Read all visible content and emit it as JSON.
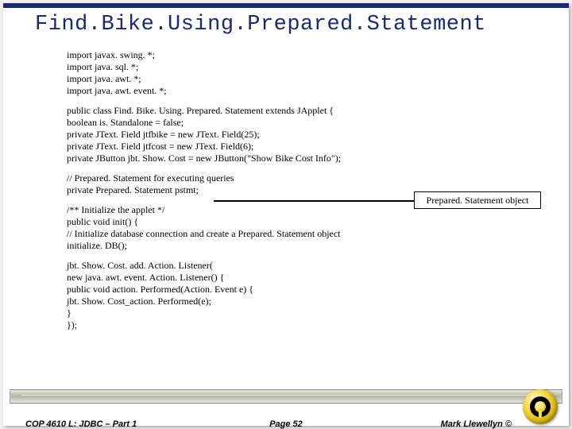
{
  "title": "Find.Bike.Using.Prepared.Statement",
  "code": {
    "imports": [
      "import javax. swing. *;",
      "import java. sql. *;",
      "import java. awt. *;",
      "import java. awt. event. *;"
    ],
    "classDecl": "public class Find. Bike. Using. Prepared. Statement extends JApplet {",
    "fields": [
      " boolean is. Standalone = false;",
      " private JText. Field jtfbike = new JText. Field(25);",
      " private JText. Field jtfcost = new JText. Field(6);",
      " private JButton jbt. Show. Cost = new JButton(\"Show Bike Cost Info\");"
    ],
    "pstmtComment": " // Prepared. Statement for executing queries",
    "pstmtDecl": " private Prepared. Statement pstmt;",
    "initComment": " /** Initialize the applet */",
    "initDecl": " public void init() {",
    "initBody1": "  // Initialize database connection and create a Prepared. Statement object",
    "initBody2": "  initialize. DB();",
    "listener": [
      "  jbt. Show. Cost. add. Action. Listener(",
      "   new java. awt. event. Action. Listener() {",
      "   public void action. Performed(Action. Event e) {",
      "    jbt. Show. Cost_action. Performed(e);",
      "   }",
      "  });"
    ]
  },
  "callout": "Prepared. Statement object",
  "footer": {
    "left": "COP 4610 L: JDBC – Part 1",
    "center": "Page 52",
    "right": "Mark Llewellyn ©"
  }
}
